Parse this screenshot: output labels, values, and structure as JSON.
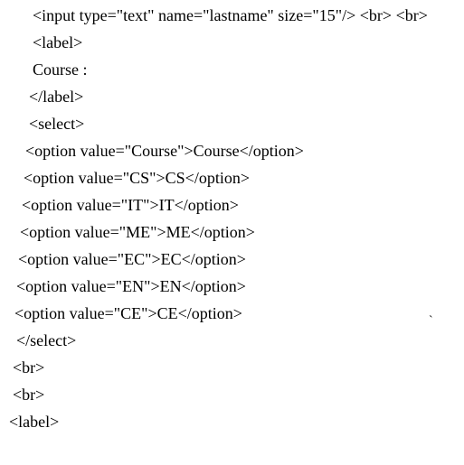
{
  "lines": {
    "l1": "<input type=\"text\" name=\"lastname\" size=\"15\"/> <br> <br>",
    "l2": "<label>",
    "l3": "Course :",
    "l4": "</label>",
    "l5": "<select>",
    "l6": "<option value=\"Course\">Course</option>",
    "l7": "<option value=\"CS\">CS</option>",
    "l8": "<option value=\"IT\">IT</option>",
    "l9": "<option value=\"ME\">ME</option>",
    "l10": "<option value=\"EC\">EC</option>",
    "l11": "<option value=\"EN\">EN</option>",
    "l12": "<option value=\"CE\">CE</option>",
    "l13": "</select>",
    "l14": "<br>",
    "l15": "<br>",
    "l16": "<label>"
  },
  "tick_mark": "`"
}
